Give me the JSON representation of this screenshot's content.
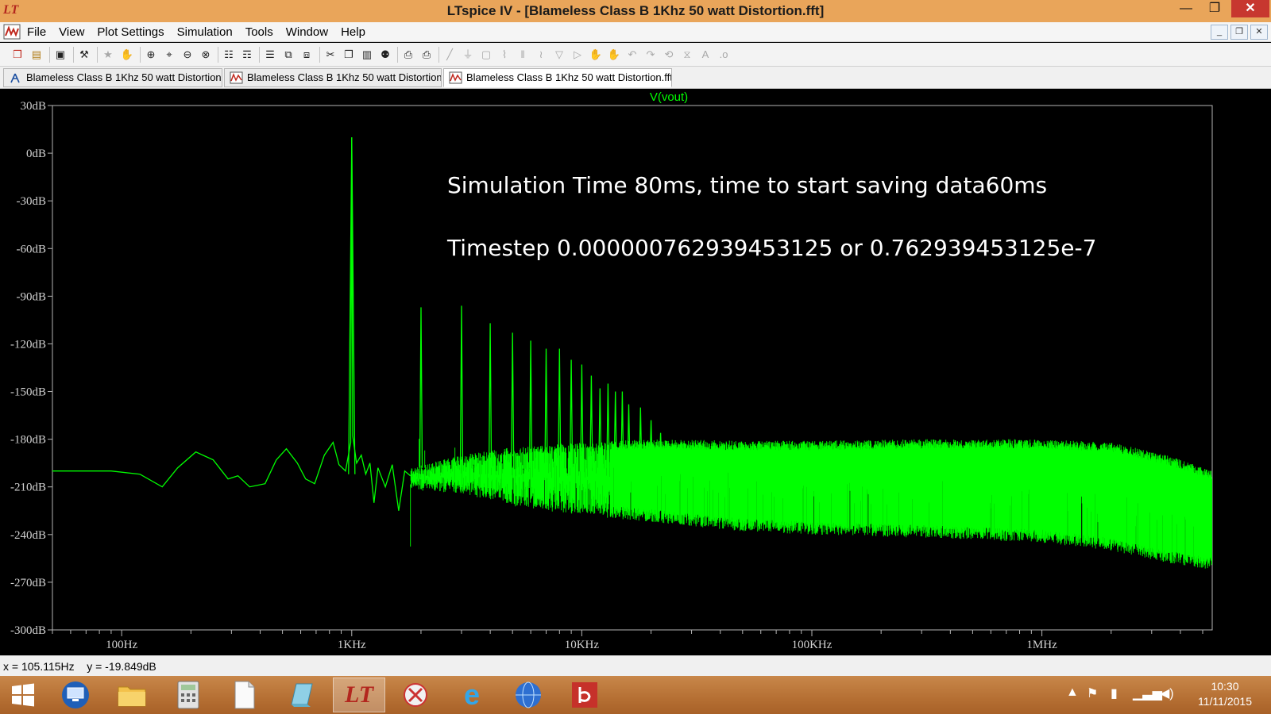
{
  "window": {
    "title": "LTspice IV - [Blameless Class B 1Khz 50 watt Distortion.fft]",
    "app_icon": "LT"
  },
  "menu": [
    "File",
    "View",
    "Plot Settings",
    "Simulation",
    "Tools",
    "Window",
    "Help"
  ],
  "tabs": [
    {
      "label": "Blameless Class B 1Khz 50 watt Distortion",
      "icon": "schematic-icon",
      "active": false
    },
    {
      "label": "Blameless Class B 1Khz 50 watt Distortion",
      "icon": "waveform-icon",
      "active": false
    },
    {
      "label": "Blameless Class B 1Khz 50 watt Distortion.fft",
      "icon": "fft-icon",
      "active": true
    }
  ],
  "colors": {
    "trace": "#00ff00",
    "plot_bg": "#000000",
    "axis": "#b4b4b4",
    "titlebar": "#e9a55a"
  },
  "chart_data": {
    "type": "line",
    "series": [
      {
        "name": "V(vout)",
        "color": "#00ff00"
      }
    ],
    "x_scale": "log",
    "xlim_hz": [
      50,
      5500000
    ],
    "ylim_db": [
      -300,
      30
    ],
    "x_ticks": [
      {
        "label": "100Hz",
        "value": 100
      },
      {
        "label": "1KHz",
        "value": 1000
      },
      {
        "label": "10KHz",
        "value": 10000
      },
      {
        "label": "100KHz",
        "value": 100000
      },
      {
        "label": "1MHz",
        "value": 1000000
      }
    ],
    "y_ticks": [
      {
        "label": "30dB",
        "value": 30
      },
      {
        "label": "0dB",
        "value": 0
      },
      {
        "label": "-30dB",
        "value": -30
      },
      {
        "label": "-60dB",
        "value": -60
      },
      {
        "label": "-90dB",
        "value": -90
      },
      {
        "label": "-120dB",
        "value": -120
      },
      {
        "label": "-150dB",
        "value": -150
      },
      {
        "label": "-180dB",
        "value": -180
      },
      {
        "label": "-210dB",
        "value": -210
      },
      {
        "label": "-240dB",
        "value": -240
      },
      {
        "label": "-270dB",
        "value": -270
      },
      {
        "label": "-300dB",
        "value": -300
      }
    ],
    "low_freq_curve": [
      [
        50,
        -200
      ],
      [
        90,
        -200
      ],
      [
        120,
        -202
      ],
      [
        150,
        -210
      ],
      [
        175,
        -198
      ],
      [
        210,
        -188
      ],
      [
        250,
        -193
      ],
      [
        290,
        -205
      ],
      [
        320,
        -203
      ],
      [
        360,
        -210
      ],
      [
        420,
        -208
      ],
      [
        470,
        -193
      ],
      [
        520,
        -186
      ],
      [
        580,
        -195
      ],
      [
        630,
        -205
      ],
      [
        690,
        -208
      ],
      [
        760,
        -190
      ],
      [
        830,
        -182
      ],
      [
        880,
        -196
      ],
      [
        940,
        -200
      ],
      [
        990,
        -182
      ],
      [
        1000,
        10
      ],
      [
        1010,
        -178
      ],
      [
        1050,
        -195
      ],
      [
        1100,
        -190
      ],
      [
        1150,
        -202
      ],
      [
        1200,
        -195
      ],
      [
        1250,
        -220
      ],
      [
        1300,
        -198
      ],
      [
        1400,
        -210
      ],
      [
        1500,
        -196
      ],
      [
        1600,
        -225
      ],
      [
        1700,
        -200
      ],
      [
        1800,
        -203
      ]
    ],
    "harmonics": [
      [
        1000,
        10
      ],
      [
        2000,
        -97
      ],
      [
        3000,
        -96
      ],
      [
        4000,
        -107
      ],
      [
        5000,
        -113
      ],
      [
        6000,
        -118
      ],
      [
        7000,
        -123
      ],
      [
        8000,
        -123
      ],
      [
        9000,
        -130
      ],
      [
        10000,
        -133
      ],
      [
        11000,
        -140
      ],
      [
        12000,
        -148
      ],
      [
        13000,
        -145
      ],
      [
        14000,
        -150
      ],
      [
        15000,
        -150
      ],
      [
        16000,
        -158
      ],
      [
        18000,
        -160
      ],
      [
        20000,
        -168
      ],
      [
        22000,
        -176
      ]
    ],
    "noise_envelope": [
      [
        1800,
        -198,
        -212
      ],
      [
        3000,
        -190,
        -214
      ],
      [
        5000,
        -185,
        -222
      ],
      [
        10000,
        -182,
        -228
      ],
      [
        20000,
        -180,
        -232
      ],
      [
        50000,
        -181,
        -238
      ],
      [
        100000,
        -181,
        -240
      ],
      [
        300000,
        -180,
        -242
      ],
      [
        1000000,
        -180,
        -245
      ],
      [
        2000000,
        -182,
        -250
      ],
      [
        3500000,
        -190,
        -258
      ],
      [
        5500000,
        -200,
        -262
      ]
    ],
    "annotations": [
      "Simulation Time 80ms, time to start saving data60ms",
      "Timestep 0.000000762939453125 or 0.762939453125e-7"
    ]
  },
  "status": {
    "x_readout": "x = 105.115Hz",
    "y_readout": "y = -19.849dB"
  },
  "taskbar": {
    "items": [
      "windows-start-icon",
      "remote-desktop-icon",
      "file-explorer-icon",
      "calculator-icon",
      "document-icon",
      "notepad-icon",
      "ltspice-icon",
      "snipping-tool-icon",
      "internet-explorer-icon",
      "globe-icon",
      "acrobat-icon"
    ],
    "time": "10:30",
    "date": "11/11/2015"
  }
}
